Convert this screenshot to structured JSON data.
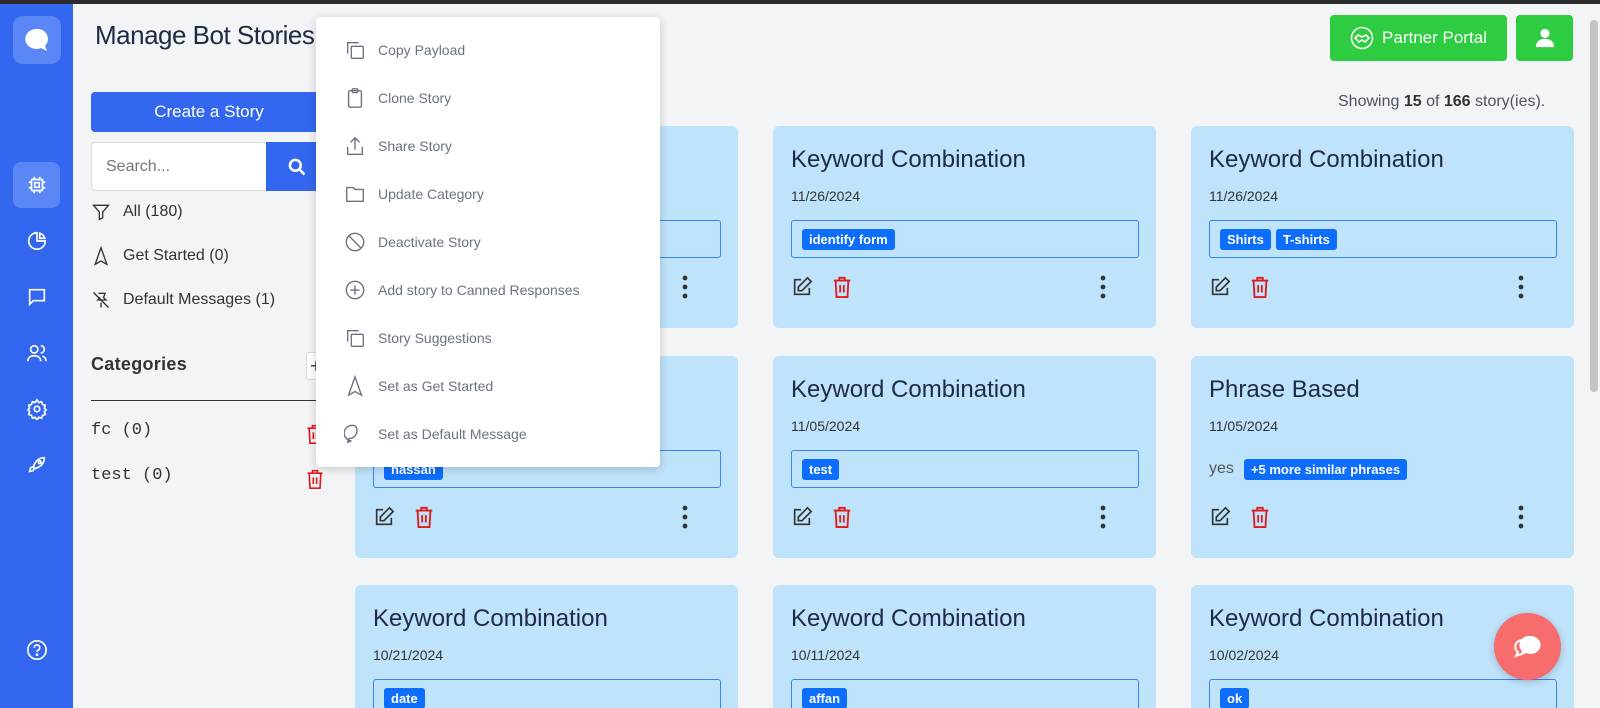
{
  "page": {
    "title": "Manage Bot Stories"
  },
  "header": {
    "partner_portal_label": "Partner Portal"
  },
  "sidebar": {
    "create_label": "Create a Story",
    "search_placeholder": "Search...",
    "filters": [
      {
        "label": "All (180)",
        "icon": "filter-icon"
      },
      {
        "label": "Get Started (0)",
        "icon": "navigation-arrow-icon"
      },
      {
        "label": "Default Messages (1)",
        "icon": "pin-off-icon"
      }
    ],
    "categories_heading": "Categories",
    "categories": [
      {
        "label": "fc (0)"
      },
      {
        "label": "test (0)"
      }
    ]
  },
  "summary": {
    "prefix": "Showing ",
    "shown": "15",
    "middle": " of ",
    "total": "166",
    "suffix": " story(ies)."
  },
  "menu": {
    "items": [
      {
        "label": "Copy Payload",
        "icon": "copy-icon"
      },
      {
        "label": "Clone Story",
        "icon": "clipboard-icon"
      },
      {
        "label": "Share Story",
        "icon": "share-icon"
      },
      {
        "label": "Update Category",
        "icon": "folder-icon"
      },
      {
        "label": "Deactivate Story",
        "icon": "ban-icon"
      },
      {
        "label": "Add story to Canned Responses",
        "icon": "plus-circle-icon"
      },
      {
        "label": "Story Suggestions",
        "icon": "copy-icon"
      },
      {
        "label": "Set as Get Started",
        "icon": "navigation-arrow-icon"
      },
      {
        "label": "Set as Default Message",
        "icon": "chat-bubble-icon"
      }
    ],
    "highlighted": "Clone Story"
  },
  "cards": [
    {
      "title": "Keyword Combination",
      "date": "11/26/2024",
      "tags": [
        "identify form"
      ]
    },
    {
      "title": "Keyword Combination",
      "date": "11/26/2024",
      "tags": [
        "Shirts",
        "T-shirts"
      ]
    },
    {
      "title": "",
      "date": "",
      "tags": [
        "hassan"
      ]
    },
    {
      "title": "Keyword Combination",
      "date": "11/05/2024",
      "tags": [
        "test"
      ]
    },
    {
      "title": "Phrase Based",
      "date": "11/05/2024",
      "phrase": "yes",
      "more": "+5 more similar phrases"
    },
    {
      "title": "Keyword Combination",
      "date": "10/21/2024",
      "tags": [
        "date"
      ]
    },
    {
      "title": "Keyword Combination",
      "date": "10/11/2024",
      "tags": [
        "affan"
      ]
    },
    {
      "title": "Keyword Combination",
      "date": "10/02/2024",
      "tags": [
        "ok"
      ]
    }
  ],
  "colors": {
    "primary": "#3467f0",
    "green": "#2ecc40",
    "card": "#bfe3fb",
    "tag": "#0d6efd",
    "danger": "#e01b1b"
  }
}
